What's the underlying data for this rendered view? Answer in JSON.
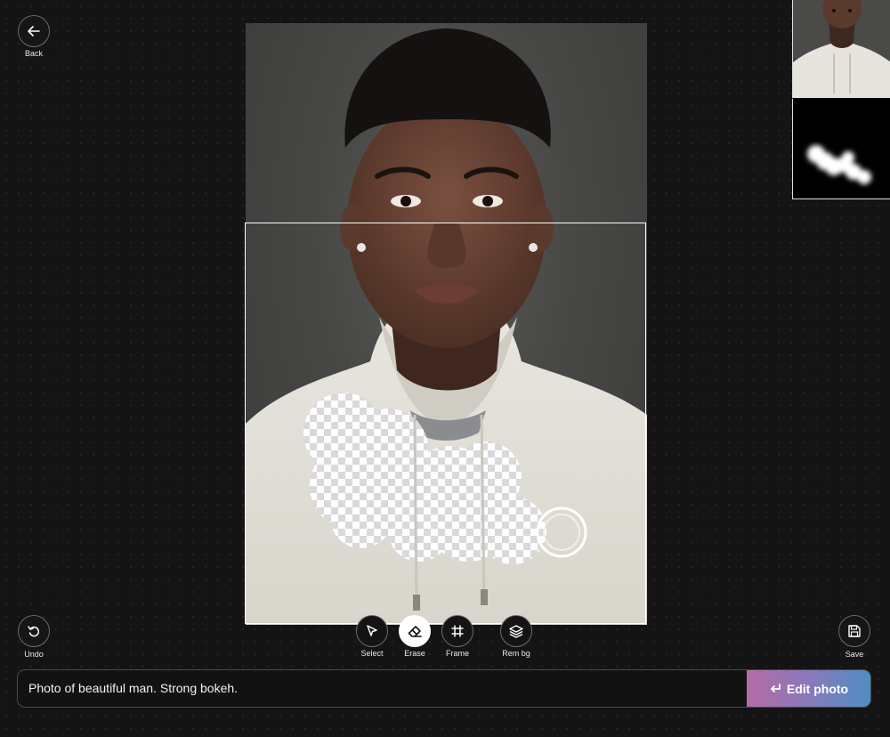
{
  "nav": {
    "back_label": "Back",
    "undo_label": "Undo",
    "save_label": "Save"
  },
  "tools": [
    {
      "label": "Select",
      "icon": "cursor-arrow-icon",
      "active": false
    },
    {
      "label": "Erase",
      "icon": "eraser-icon",
      "active": true
    },
    {
      "label": "Frame",
      "icon": "frame-hash-icon",
      "active": false
    },
    {
      "label": "Rem bg",
      "icon": "layers-icon",
      "active": false
    }
  ],
  "prompt": {
    "value": "Photo of beautiful man. Strong bokeh."
  },
  "action": {
    "label": "Edit photo",
    "icon": "enter-return-icon"
  },
  "colors": {
    "background": "#141414",
    "frame": "#ffffff",
    "gradient_start": "#b36ca4",
    "gradient_end": "#4f8ec2"
  }
}
